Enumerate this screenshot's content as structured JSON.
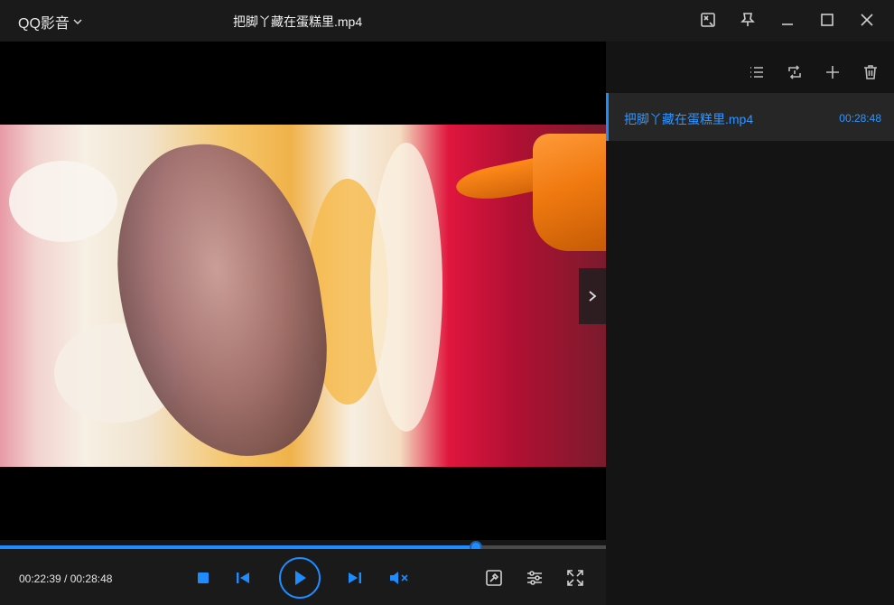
{
  "app": {
    "name": "QQ影音",
    "title": "把脚丫藏在蛋糕里.mp4"
  },
  "window_controls": [
    "screenshot-icon",
    "pin-icon",
    "minimize-icon",
    "maximize-icon",
    "close-icon"
  ],
  "player": {
    "current_time": "00:22:39",
    "total_time": "00:28:48",
    "time_display": "00:22:39 / 00:28:48",
    "progress_fraction": 0.786
  },
  "controls": {
    "stop": "stop-icon",
    "previous": "previous-icon",
    "play": "play-icon",
    "next": "next-icon",
    "mute": "muted-volume-icon",
    "tools": "toolbox-icon",
    "settings": "equalizer-icon",
    "fullscreen": "fullscreen-icon"
  },
  "playlist": {
    "toolbar": [
      "list-icon",
      "loop-once-icon",
      "add-icon",
      "delete-icon"
    ],
    "items": [
      {
        "name": "把脚丫藏在蛋糕里.mp4",
        "duration": "00:28:48"
      }
    ]
  },
  "colors": {
    "accent": "#1e8cff",
    "background": "#161616",
    "panel": "#141414"
  }
}
